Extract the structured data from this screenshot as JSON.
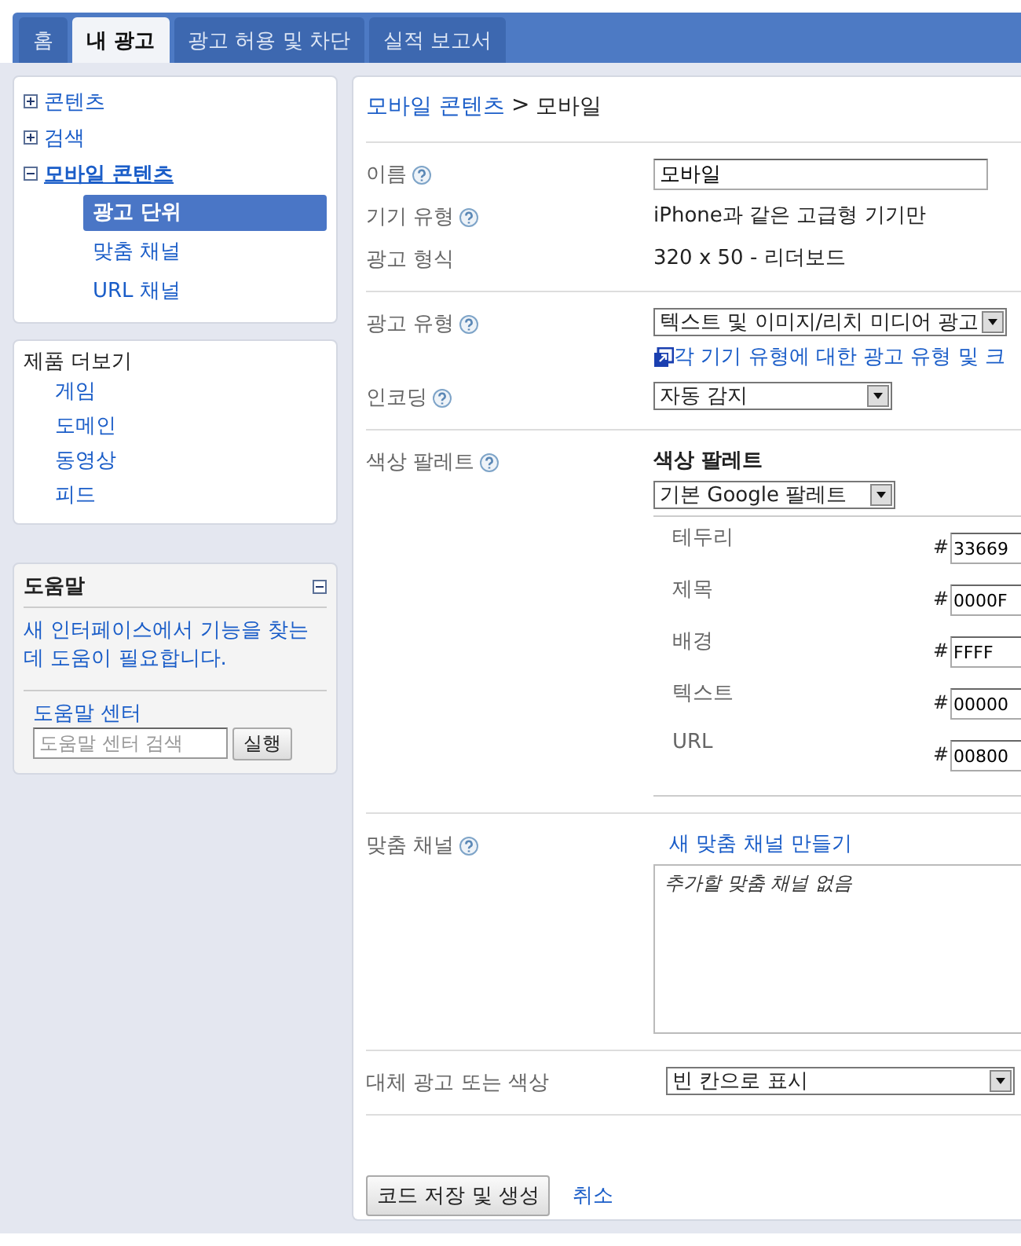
{
  "tabs": [
    {
      "label": "홈",
      "selected": false
    },
    {
      "label": "내 광고",
      "selected": true
    },
    {
      "label": "광고 허용 및 차단",
      "selected": false
    },
    {
      "label": "실적 보고서",
      "selected": false
    }
  ],
  "sidebar": {
    "nav": [
      {
        "label": "콘텐츠",
        "expanded": false,
        "selected": false
      },
      {
        "label": "검색",
        "expanded": false,
        "selected": false
      },
      {
        "label": "모바일 콘텐츠",
        "expanded": true,
        "selected": true,
        "children": [
          {
            "label": "광고 단위",
            "selected": true
          },
          {
            "label": "맞춤 채널",
            "selected": false
          },
          {
            "label": "URL 채널",
            "selected": false
          }
        ]
      }
    ],
    "more_products": {
      "title": "제품 더보기",
      "links": [
        "게임",
        "도메인",
        "동영상",
        "피드"
      ]
    },
    "help": {
      "title": "도움말",
      "text": "새 인터페이스에서 기능을 찾는데 도움이 필요합니다.",
      "center_link": "도움말 센터",
      "search_placeholder": "도움말 센터 검색",
      "go_button": "실행"
    }
  },
  "main": {
    "breadcrumb": {
      "link": "모바일 콘텐츠",
      "separator": ">",
      "current": "모바일"
    },
    "sections": [
      [
        {
          "kind": "input",
          "label": "이름",
          "help": true,
          "value": "모바일"
        },
        {
          "kind": "text",
          "label": "기기 유형",
          "help": true,
          "value": "iPhone과 같은 고급형 기기만"
        },
        {
          "kind": "text",
          "label": "광고 형식",
          "help": false,
          "value": "320 x 50 - 리더보드"
        }
      ],
      [
        {
          "kind": "select",
          "label": "광고 유형",
          "help": true,
          "value": "텍스트 및 이미지/리치 미디어 광고",
          "link": "각 기기 유형에 대한 광고 유형 및 크"
        },
        {
          "kind": "select",
          "label": "인코딩",
          "help": true,
          "value": "자동 감지"
        }
      ],
      [
        {
          "kind": "palette",
          "label": "색상 팔레트",
          "help": true,
          "title": "색상 팔레트",
          "value": "기본 Google 팔레트",
          "colors": [
            {
              "name": "테두리",
              "prefix": "#",
              "value": "33669"
            },
            {
              "name": "제목",
              "prefix": "#",
              "value": "0000F"
            },
            {
              "name": "배경",
              "prefix": "#",
              "value": "FFFF"
            },
            {
              "name": "텍스트",
              "prefix": "#",
              "value": "00000"
            },
            {
              "name": "URL",
              "prefix": "#",
              "value": "00800"
            }
          ]
        }
      ],
      [
        {
          "kind": "channels",
          "label": "맞춤 채널",
          "help": true,
          "link": "새 맞춤 채널 만들기",
          "empty_text": "추가할 맞춤 채널 없음"
        }
      ],
      [
        {
          "kind": "select",
          "label": "대체 광고 또는 색상",
          "help": false,
          "value": "빈 칸으로 표시"
        }
      ]
    ],
    "actions": {
      "save": "코드 저장 및 생성",
      "cancel": "취소"
    }
  }
}
